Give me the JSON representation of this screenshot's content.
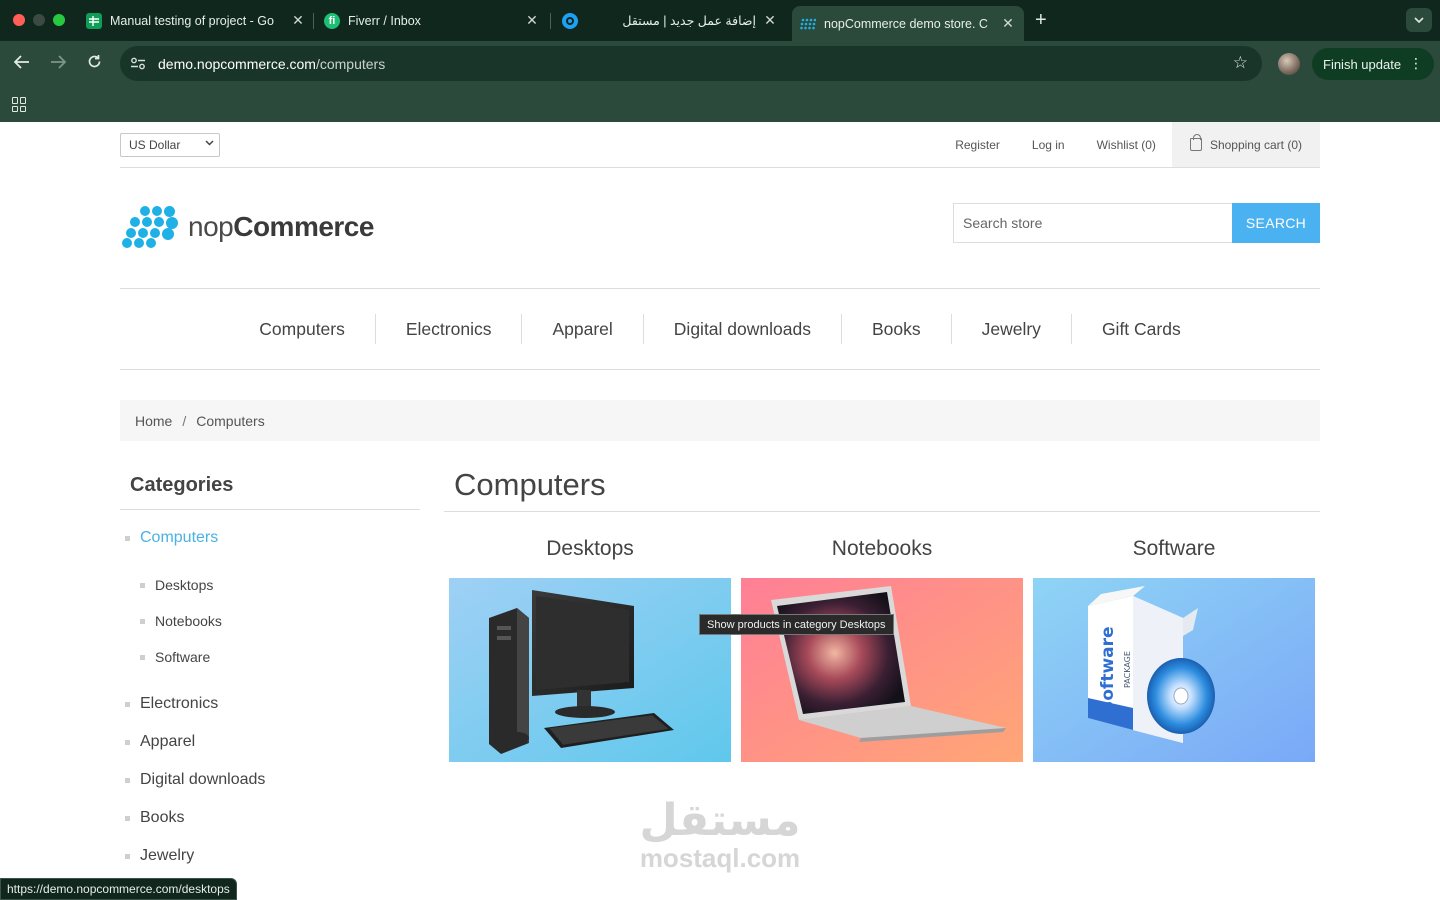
{
  "browser": {
    "tabs": [
      {
        "title": "Manual testing of project - Go",
        "icon": "google-sheets-icon",
        "color": "#0f9d58"
      },
      {
        "title": "Fiverr / Inbox",
        "icon": "fiverr-icon",
        "color": "#1dbf73"
      },
      {
        "title": "إضافة عمل جديد | مستقل",
        "icon": "mostaql-icon",
        "color": "#1da1f2"
      },
      {
        "title": "nopCommerce demo store. C",
        "icon": "nopcommerce-icon",
        "color": "#1fb0e6"
      }
    ],
    "url_host": "demo.nopcommerce.com",
    "url_path": "/computers",
    "finish_update_label": "Finish update",
    "status_url": "https://demo.nopcommerce.com/desktops"
  },
  "header": {
    "currency": "US Dollar",
    "links": {
      "register": "Register",
      "login": "Log in",
      "wishlist": "Wishlist (0)",
      "cart": "Shopping cart (0)"
    },
    "logo_text_light": "nop",
    "logo_text_bold": "Commerce",
    "search_placeholder": "Search store",
    "search_button": "SEARCH"
  },
  "menu": [
    "Computers",
    "Electronics",
    "Apparel",
    "Digital downloads",
    "Books",
    "Jewelry",
    "Gift Cards"
  ],
  "breadcrumb": {
    "home": "Home",
    "separator": "/",
    "current": "Computers"
  },
  "sidebar": {
    "title": "Categories",
    "items": [
      {
        "label": "Computers",
        "active": true
      },
      {
        "label": "Desktops",
        "sub": true
      },
      {
        "label": "Notebooks",
        "sub": true
      },
      {
        "label": "Software",
        "sub": true
      },
      {
        "label": "Electronics"
      },
      {
        "label": "Apparel"
      },
      {
        "label": "Digital downloads"
      },
      {
        "label": "Books"
      },
      {
        "label": "Jewelry"
      }
    ]
  },
  "main": {
    "title": "Computers",
    "subcategories": [
      {
        "title": "Desktops",
        "image": "desktop-computer-picture"
      },
      {
        "title": "Notebooks",
        "image": "notebook-laptop-picture"
      },
      {
        "title": "Software",
        "image": "software-box-picture"
      }
    ],
    "tooltip": "Show products in category Desktops"
  },
  "watermark": {
    "arabic": "مستقل",
    "latin": "mostaql.com"
  },
  "colors": {
    "accent": "#4ab2f1",
    "active_link": "#4ab2e3",
    "chrome_bg": "#2b4a3c",
    "tabbar_bg": "#10271d"
  }
}
